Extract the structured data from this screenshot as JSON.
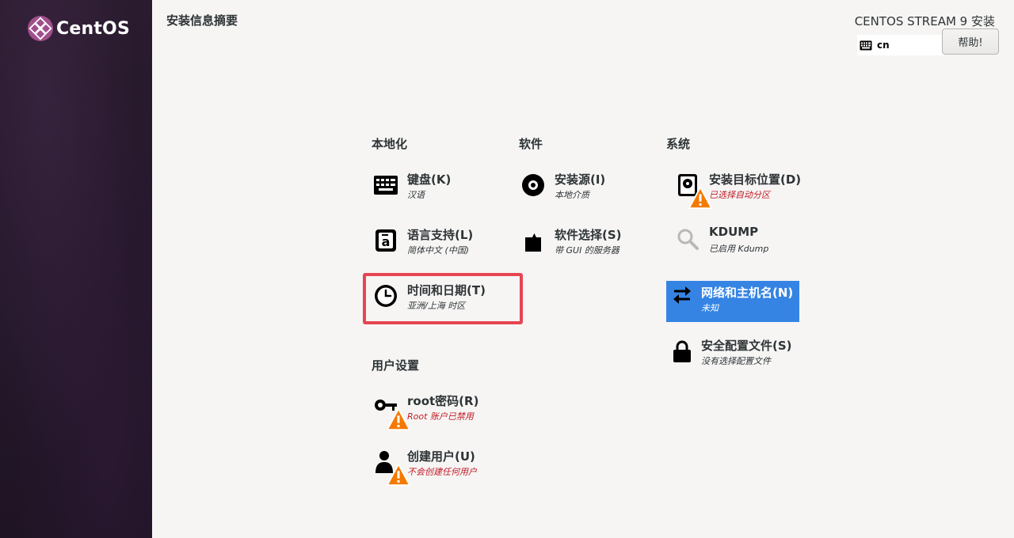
{
  "app": {
    "logo_text": "CentOS",
    "page_title": "安装信息摘要",
    "product_title": "CENTOS STREAM 9 安装",
    "keyboard_layout": "cn",
    "help_label": "帮助!"
  },
  "sections": {
    "localization": {
      "heading": "本地化",
      "keyboard": {
        "title": "键盘(K)",
        "status": "汉语"
      },
      "language": {
        "title": "语言支持(L)",
        "status": "简体中文 (中国)"
      },
      "datetime": {
        "title": "时间和日期(T)",
        "status": "亚洲/上海 时区"
      }
    },
    "software": {
      "heading": "软件",
      "source": {
        "title": "安装源(I)",
        "status": "本地介质"
      },
      "selection": {
        "title": "软件选择(S)",
        "status": "带 GUI 的服务器"
      }
    },
    "system": {
      "heading": "系统",
      "destination": {
        "title": "安装目标位置(D)",
        "status": "已选择自动分区"
      },
      "kdump": {
        "title": "KDUMP",
        "status": "已启用 Kdump"
      },
      "network": {
        "title": "网络和主机名(N)",
        "status": "未知"
      },
      "security": {
        "title": "安全配置文件(S)",
        "status": "没有选择配置文件"
      }
    },
    "user": {
      "heading": "用户设置",
      "root": {
        "title": "root密码(R)",
        "status": "Root 账户已禁用"
      },
      "create_user": {
        "title": "创建用户(U)",
        "status": "不会创建任何用户"
      }
    }
  },
  "colors": {
    "accent": "#3584e4",
    "warning_text": "#c01c28",
    "warning_icon": "#f57900",
    "highlight": "#e64553"
  }
}
